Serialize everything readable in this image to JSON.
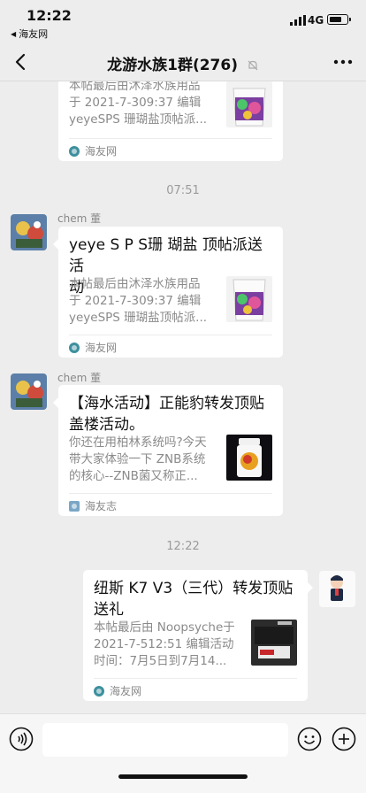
{
  "status": {
    "time": "12:22",
    "back_app": "海友网",
    "network": "4G",
    "battery_level": 0.75
  },
  "nav": {
    "title": "龙游水族1群(276)",
    "back_icon": "chevron-left-icon",
    "more_icon": "more-dots-icon",
    "muted": true
  },
  "messages": [
    {
      "type": "link-card",
      "side": "left",
      "title": "",
      "desc": [
        "本帖最后由沐泽水族用品",
        "于 2021-7-309:37 编辑",
        "yeyeSPS 珊瑚盐顶帖派..."
      ],
      "source": "海友网"
    },
    {
      "type": "time",
      "text": "07:51"
    },
    {
      "type": "link-card",
      "side": "left",
      "sender": "chem 董",
      "title": [
        "yeye S P S珊 瑚盐 顶帖派送活",
        "动"
      ],
      "desc": [
        "本帖最后由沐泽水族用品",
        "于 2021-7-309:37 编辑",
        "yeyeSPS 珊瑚盐顶帖派..."
      ],
      "source": "海友网"
    },
    {
      "type": "link-card",
      "side": "left",
      "sender": "chem 董",
      "title": [
        "【海水活动】正能豹转发顶贴",
        "盖楼活动。"
      ],
      "desc": [
        "你还在用柏林系统吗?今天",
        "带大家体验一下 ZNB系统",
        "的核心--ZNB菌又称正..."
      ],
      "source": "海友志"
    },
    {
      "type": "time",
      "text": "12:22"
    },
    {
      "type": "link-card",
      "side": "right",
      "title": [
        "纽斯 K7 V3（三代）转发顶贴",
        "送礼"
      ],
      "desc": [
        "本帖最后由 Noopsyche于",
        "2021-7-512:51 编辑活动",
        "时间：7月5日到7月14..."
      ],
      "source": "海友网"
    }
  ],
  "input": {
    "value": "",
    "placeholder": ""
  },
  "colors": {
    "background": "#ededed",
    "bubble": "#ffffff",
    "source_icon": "#3d8f9e"
  }
}
